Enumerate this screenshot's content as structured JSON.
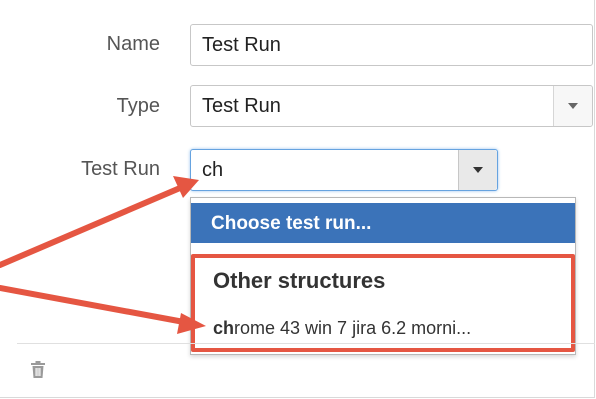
{
  "form": {
    "name_label": "Name",
    "name_value": "Test Run",
    "type_label": "Type",
    "type_value": "Test Run",
    "testrun_label": "Test Run",
    "testrun_value": "ch"
  },
  "dropdown": {
    "highlighted_option": "Choose test run...",
    "group_header": "Other structures",
    "item_match": "ch",
    "item_rest": "rome 43 win 7 jira 6.2 morni..."
  },
  "icons": {
    "trash": "trash-icon",
    "caret": "chevron-down-icon"
  },
  "colors": {
    "highlight": "#3b73b9",
    "annotation": "#e55642",
    "focus": "#66a3e0"
  }
}
